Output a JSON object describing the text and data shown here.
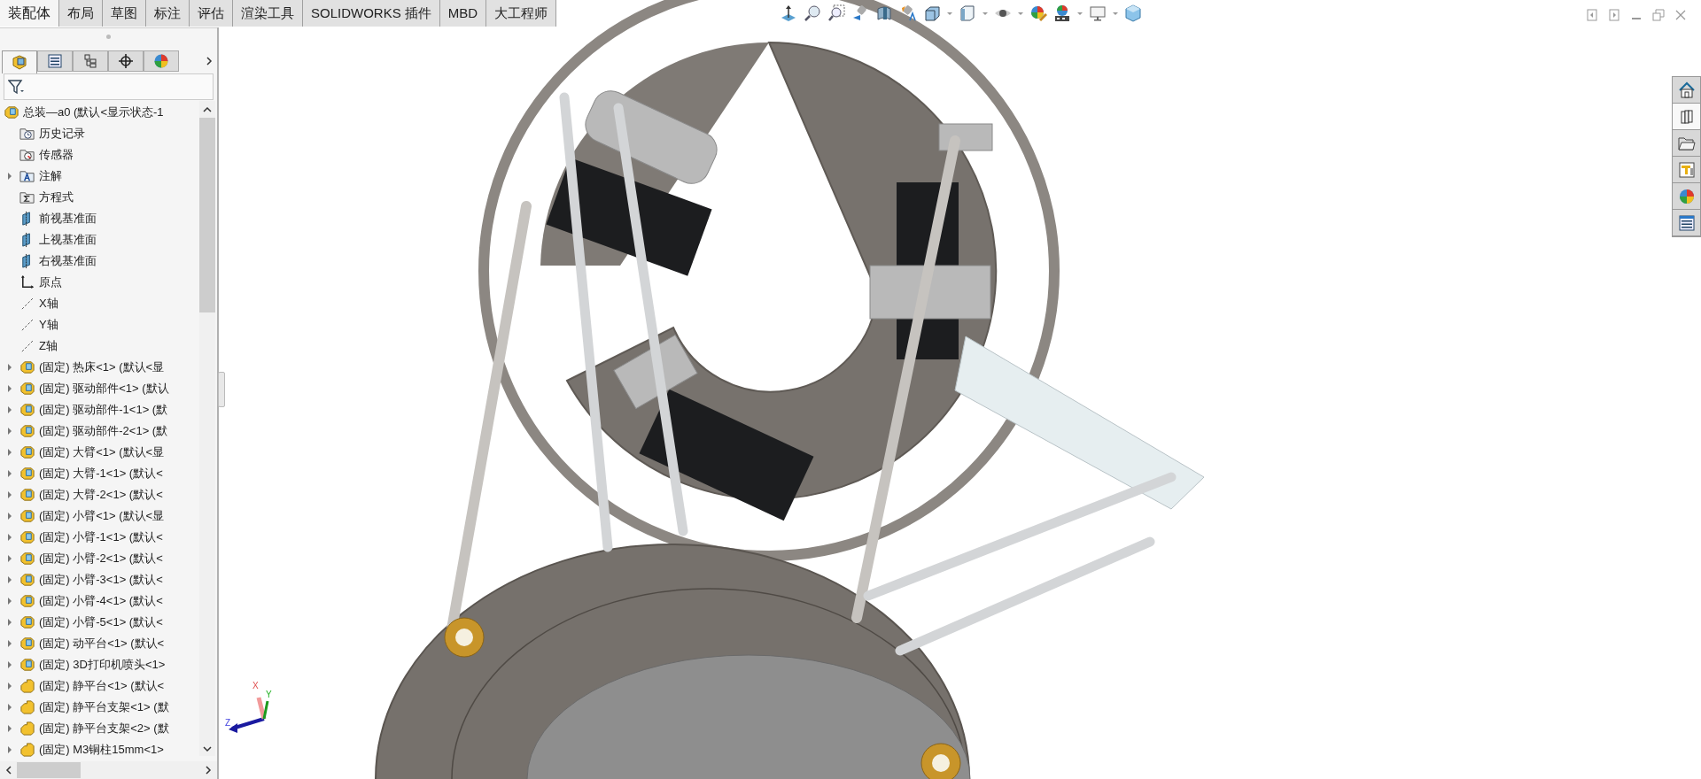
{
  "command_tabs": [
    {
      "label": "装配体",
      "selected": true
    },
    {
      "label": "布局",
      "selected": false
    },
    {
      "label": "草图",
      "selected": false
    },
    {
      "label": "标注",
      "selected": false
    },
    {
      "label": "评估",
      "selected": false
    },
    {
      "label": "渲染工具",
      "selected": false
    },
    {
      "label": "SOLIDWORKS 插件",
      "selected": false
    },
    {
      "label": "MBD",
      "selected": false
    },
    {
      "label": "大工程师",
      "selected": false
    }
  ],
  "feature_manager": {
    "tabs": [
      {
        "selected": true
      },
      {
        "selected": false
      },
      {
        "selected": false
      },
      {
        "selected": false
      },
      {
        "selected": false
      }
    ],
    "tree": [
      {
        "label": "总装—a0 (默认<显示状态-1",
        "kind": "assembly",
        "children": [
          {
            "label": "历史记录",
            "kind": "history"
          },
          {
            "label": "传感器",
            "kind": "sensor"
          },
          {
            "label": "注解",
            "kind": "annotation",
            "expanded": false
          },
          {
            "label": "方程式",
            "kind": "equation"
          },
          {
            "label": "前视基准面",
            "kind": "plane"
          },
          {
            "label": "上视基准面",
            "kind": "plane"
          },
          {
            "label": "右视基准面",
            "kind": "plane"
          },
          {
            "label": "原点",
            "kind": "origin"
          },
          {
            "label": "X轴",
            "kind": "axis"
          },
          {
            "label": "Y轴",
            "kind": "axis"
          },
          {
            "label": "Z轴",
            "kind": "axis"
          },
          {
            "label": "(固定) 热床<1> (默认<显",
            "kind": "assembly",
            "expanded": false
          },
          {
            "label": "(固定) 驱动部件<1> (默认",
            "kind": "assembly",
            "expanded": false
          },
          {
            "label": "(固定) 驱动部件-1<1> (默",
            "kind": "assembly",
            "expanded": false
          },
          {
            "label": "(固定) 驱动部件-2<1> (默",
            "kind": "assembly",
            "expanded": false
          },
          {
            "label": "(固定) 大臂<1> (默认<显",
            "kind": "assembly",
            "expanded": false
          },
          {
            "label": "(固定) 大臂-1<1> (默认<",
            "kind": "assembly",
            "expanded": false
          },
          {
            "label": "(固定) 大臂-2<1> (默认<",
            "kind": "assembly",
            "expanded": false
          },
          {
            "label": "(固定) 小臂<1> (默认<显",
            "kind": "assembly",
            "expanded": false
          },
          {
            "label": "(固定) 小臂-1<1> (默认<",
            "kind": "assembly",
            "expanded": false
          },
          {
            "label": "(固定) 小臂-2<1> (默认<",
            "kind": "assembly",
            "expanded": false
          },
          {
            "label": "(固定) 小臂-3<1> (默认<",
            "kind": "assembly",
            "expanded": false
          },
          {
            "label": "(固定) 小臂-4<1> (默认<",
            "kind": "assembly",
            "expanded": false
          },
          {
            "label": "(固定) 小臂-5<1> (默认<",
            "kind": "assembly",
            "expanded": false
          },
          {
            "label": "(固定) 动平台<1> (默认<",
            "kind": "assembly",
            "expanded": false
          },
          {
            "label": "(固定) 3D打印机喷头<1>",
            "kind": "assembly",
            "expanded": false
          },
          {
            "label": "(固定) 静平台<1> (默认<",
            "kind": "part",
            "expanded": false
          },
          {
            "label": "(固定) 静平台支架<1> (默",
            "kind": "part",
            "expanded": false
          },
          {
            "label": "(固定) 静平台支架<2> (默",
            "kind": "part",
            "expanded": false
          },
          {
            "label": "(固定) M3铜柱15mm<1>",
            "kind": "part",
            "expanded": false
          }
        ]
      }
    ]
  },
  "triad_axes": [
    "X",
    "Y",
    "Z"
  ],
  "task_pane": [
    {
      "selected": false
    },
    {
      "selected": true
    },
    {
      "selected": false
    },
    {
      "selected": false
    },
    {
      "selected": false
    },
    {
      "selected": false
    }
  ]
}
